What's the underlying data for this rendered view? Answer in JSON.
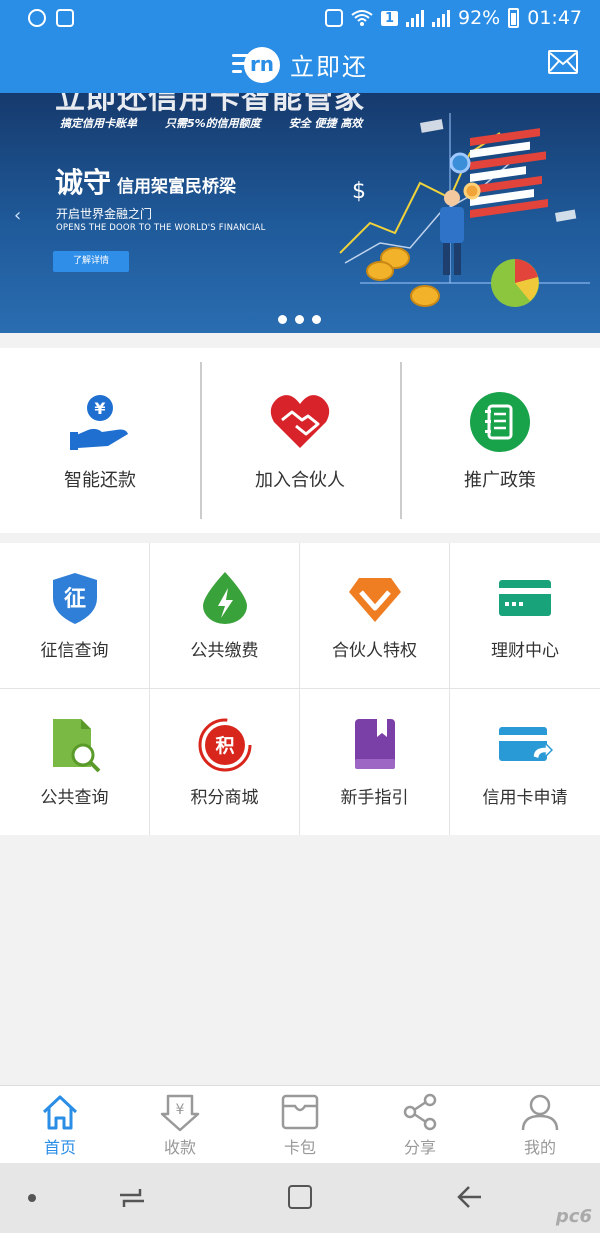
{
  "status_bar": {
    "notification_count": "1",
    "battery": "92%",
    "time": "01:47"
  },
  "header": {
    "logo_text": "rn",
    "title": "立即还"
  },
  "banner": {
    "cut_headline": "立即还信用卡智能管家",
    "slogans": [
      "搞定信用卡账单",
      "只需5%的信用额度",
      "安全  便捷  高效"
    ],
    "headline_big": "诚守",
    "headline_small": "信用架富民桥梁",
    "sub_cn": "开启世界金融之门",
    "sub_en": "OPENS THE DOOR TO THE WORLD'S FINANCIAL",
    "cta": "了解详情",
    "currency_sign": "$",
    "slide_count": 3
  },
  "features": [
    {
      "label": "智能还款",
      "icon": "hand-yen-icon",
      "color": "#1f6fd0"
    },
    {
      "label": "加入合伙人",
      "icon": "handshake-heart-icon",
      "color": "#d8232a"
    },
    {
      "label": "推广政策",
      "icon": "notebook-icon",
      "color": "#18a24a"
    }
  ],
  "grid": [
    {
      "label": "征信查询",
      "icon": "credit-shield-icon",
      "glyph": "征",
      "color": "#2f7fd8"
    },
    {
      "label": "公共缴费",
      "icon": "lightning-drop-icon",
      "color": "#3aa23a"
    },
    {
      "label": "合伙人特权",
      "icon": "diamond-icon",
      "color": "#ef7d22"
    },
    {
      "label": "理财中心",
      "icon": "bank-card-icon",
      "color": "#19a37a"
    },
    {
      "label": "公共查询",
      "icon": "document-search-icon",
      "color": "#7ab943"
    },
    {
      "label": "积分商城",
      "icon": "points-icon",
      "glyph": "积",
      "color": "#d9261c"
    },
    {
      "label": "新手指引",
      "icon": "guide-book-icon",
      "color": "#7b3fa8"
    },
    {
      "label": "信用卡申请",
      "icon": "card-apply-icon",
      "color": "#2a9ad6"
    }
  ],
  "bottom_nav": [
    {
      "label": "首页",
      "icon": "home-icon",
      "active": true
    },
    {
      "label": "收款",
      "icon": "receive-payment-icon",
      "active": false
    },
    {
      "label": "卡包",
      "icon": "wallet-icon",
      "active": false
    },
    {
      "label": "分享",
      "icon": "share-icon",
      "active": false
    },
    {
      "label": "我的",
      "icon": "profile-icon",
      "active": false
    }
  ],
  "watermark": "pc6",
  "colors": {
    "primary": "#2a8ee6",
    "inactive": "#999999",
    "background": "#f2f2f2"
  }
}
